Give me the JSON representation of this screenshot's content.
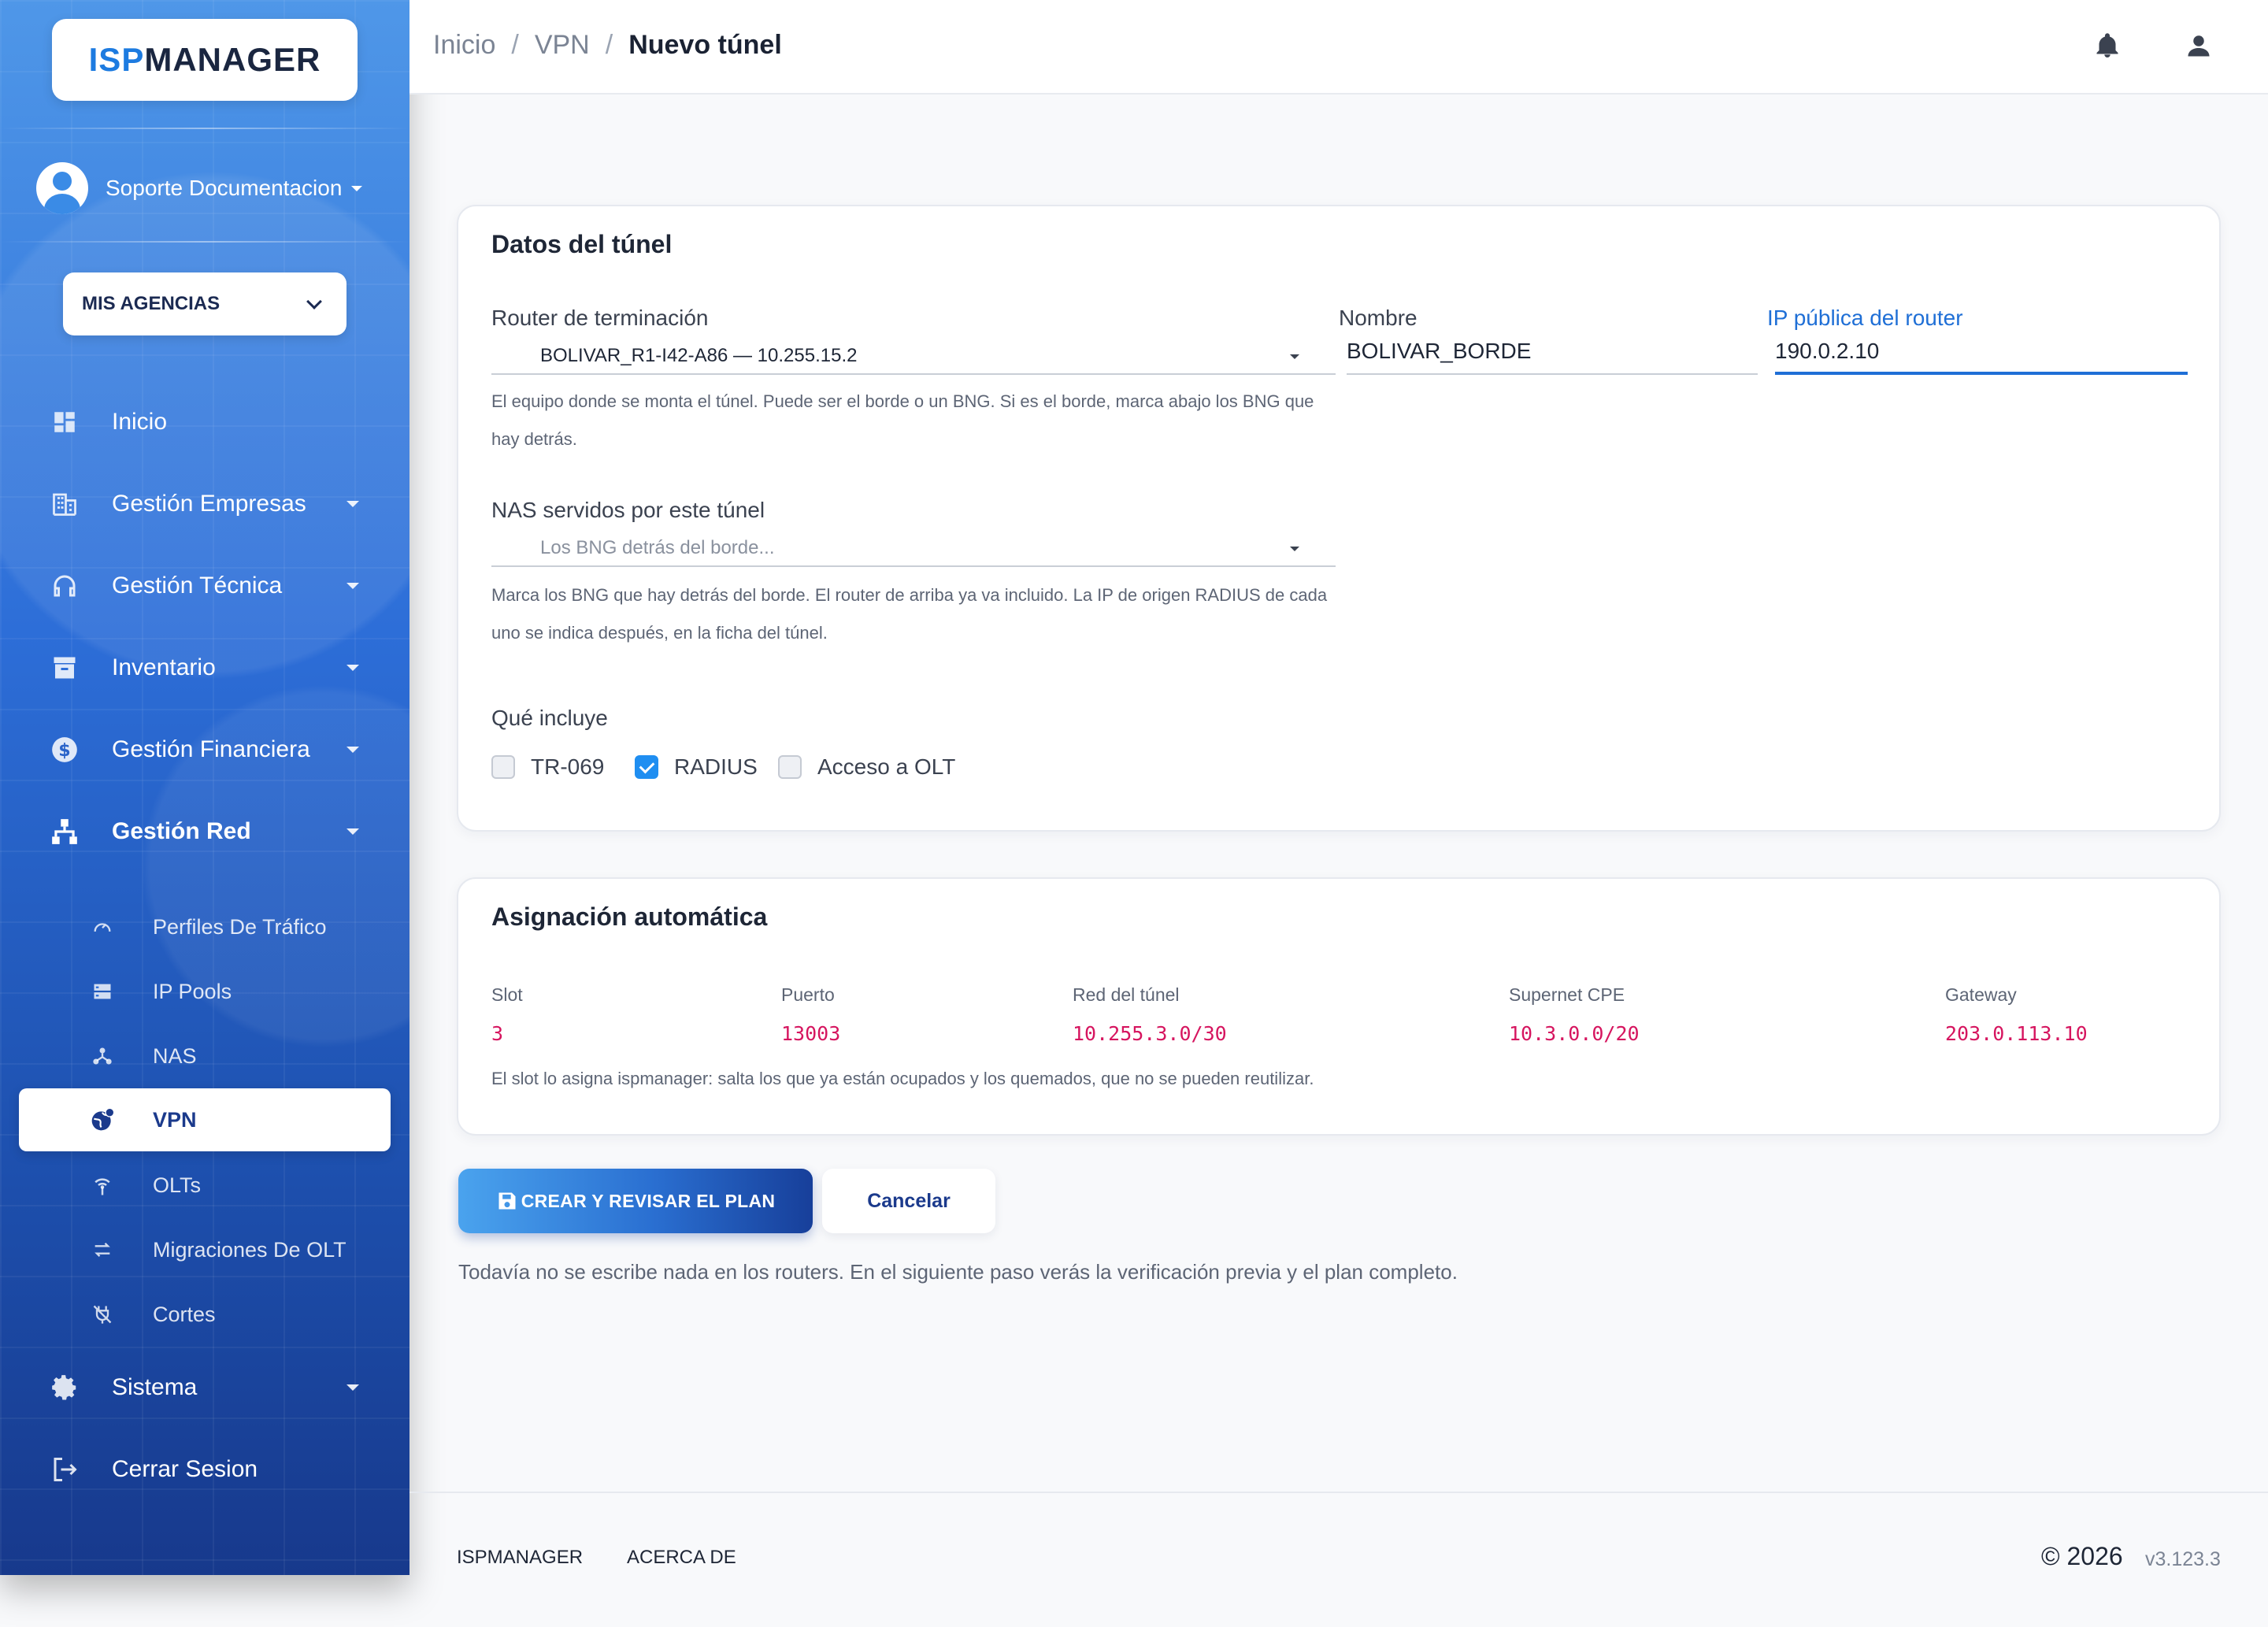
{
  "app": {
    "logo_part1": "ISP",
    "logo_part2": "MANAGER"
  },
  "user": {
    "name": "Soporte Documentacion"
  },
  "agency": {
    "label": "MIS AGENCIAS"
  },
  "sidebar": {
    "items": [
      {
        "label": "Inicio",
        "icon": "dashboard-icon"
      },
      {
        "label": "Gestión Empresas",
        "icon": "building-icon"
      },
      {
        "label": "Gestión Técnica",
        "icon": "headset-icon"
      },
      {
        "label": "Inventario",
        "icon": "archive-icon"
      },
      {
        "label": "Gestión Financiera",
        "icon": "dollar-icon"
      },
      {
        "label": "Gestión Red",
        "icon": "network-icon"
      },
      {
        "label": "Sistema",
        "icon": "gear-icon"
      },
      {
        "label": "Cerrar Sesion",
        "icon": "logout-icon"
      }
    ],
    "network_sub": [
      {
        "label": "Perfiles De Tráfico",
        "icon": "speedometer-icon"
      },
      {
        "label": "IP Pools",
        "icon": "server-icon"
      },
      {
        "label": "NAS",
        "icon": "hub-icon"
      },
      {
        "label": "VPN",
        "icon": "vpn-globe-icon"
      },
      {
        "label": "OLTs",
        "icon": "antenna-icon"
      },
      {
        "label": "Migraciones De OLT",
        "icon": "swap-icon"
      },
      {
        "label": "Cortes",
        "icon": "plug-off-icon"
      }
    ]
  },
  "breadcrumb": {
    "home": "Inicio",
    "section": "VPN",
    "current": "Nuevo túnel",
    "sep": "/"
  },
  "tunnel": {
    "title": "Datos del túnel",
    "router_label": "Router de terminación",
    "router_value": "BOLIVAR_R1-I42-A86 — 10.255.15.2",
    "router_help_1": "El equipo donde se monta el túnel. Puede ser el borde o un BNG. Si es el borde, marca abajo los BNG que",
    "router_help_2": "hay detrás.",
    "name_label": "Nombre",
    "name_value": "BOLIVAR_BORDE",
    "ip_label": "IP pública del router",
    "ip_value": "190.0.2.10",
    "nas_label": "NAS servidos por este túnel",
    "nas_placeholder": "Los BNG detrás del borde...",
    "nas_help_1": "Marca los BNG que hay detrás del borde. El router de arriba ya va incluido. La IP de origen RADIUS de cada",
    "nas_help_2": "uno se indica después, en la ficha del túnel.",
    "includes_label": "Qué incluye",
    "options": [
      {
        "label": "TR-069",
        "checked": false
      },
      {
        "label": "RADIUS",
        "checked": true
      },
      {
        "label": "Acceso a OLT",
        "checked": false
      }
    ]
  },
  "assignment": {
    "title": "Asignación automática",
    "columns": [
      {
        "label": "Slot",
        "value": "3"
      },
      {
        "label": "Puerto",
        "value": "13003"
      },
      {
        "label": "Red del túnel",
        "value": "10.255.3.0/30"
      },
      {
        "label": "Supernet CPE",
        "value": "10.3.0.0/20"
      },
      {
        "label": "Gateway",
        "value": "203.0.113.10"
      }
    ],
    "help": "El slot lo asigna ispmanager: salta los que ya están ocupados y los quemados, que no se pueden reutilizar."
  },
  "actions": {
    "create_label": "CREAR Y REVISAR EL PLAN",
    "cancel_label": "Cancelar",
    "note": "Todavía no se escribe nada en los routers. En el siguiente paso verás la verificación previa y el plan completo."
  },
  "footer": {
    "link1": "ISPMANAGER",
    "link2": "ACERCA DE",
    "copyright": "© 2026",
    "version": "v3.123.3"
  },
  "colors": {
    "accent": "#1f6fd6",
    "value_red": "#d6155f",
    "sidebar_top": "#4f97e8",
    "sidebar_bottom": "#17398c"
  }
}
